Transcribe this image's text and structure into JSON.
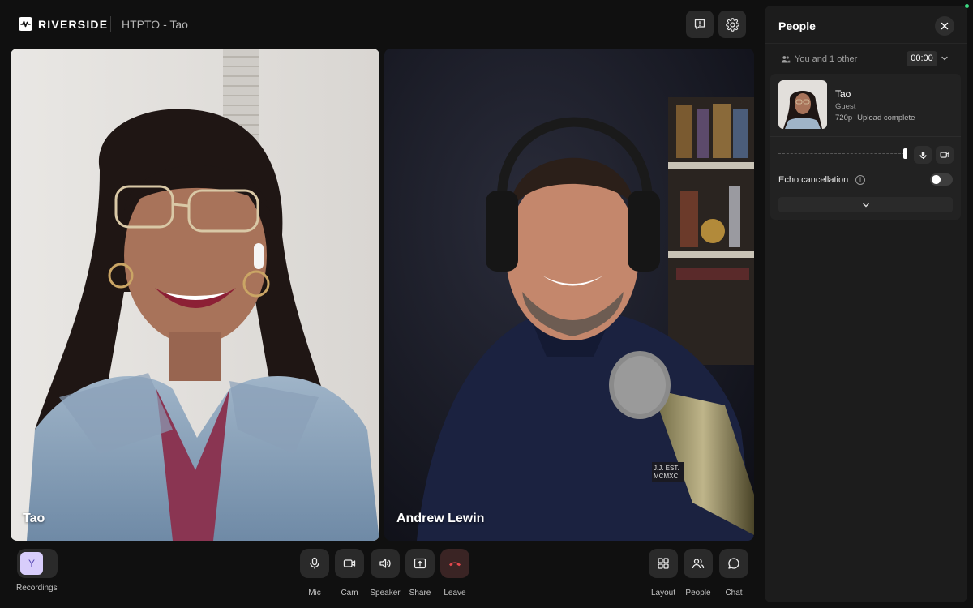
{
  "app": {
    "brand": "RIVERSIDE",
    "session_title": "HTPTO - Tao"
  },
  "header": {
    "feedback_icon": "message-alert-icon",
    "settings_icon": "gear-icon"
  },
  "tiles": [
    {
      "name": "Tao"
    },
    {
      "name": "Andrew Lewin"
    }
  ],
  "bottom_bar": {
    "recordings": {
      "avatar_initial": "Y",
      "label": "Recordings"
    },
    "controls": {
      "mic": "Mic",
      "cam": "Cam",
      "speaker": "Speaker",
      "share": "Share",
      "leave": "Leave"
    },
    "right_controls": {
      "layout": "Layout",
      "people": "People",
      "chat": "Chat"
    }
  },
  "people_panel": {
    "title": "People",
    "participant_count": "You and 1 other",
    "timer": "00:00",
    "participant": {
      "name": "Tao",
      "role": "Guest",
      "resolution": "720p",
      "upload_status": "Upload complete",
      "volume_level": 1.0
    },
    "echo_cancellation": {
      "label": "Echo cancellation",
      "info": "i",
      "enabled": false
    }
  },
  "colors": {
    "background": "#101010",
    "panel": "#1c1c1c",
    "button": "#2a2a2a",
    "leave_icon": "#e5484d",
    "avatar_bg": "#d8cdfb",
    "status_dot": "#3ddc84"
  }
}
